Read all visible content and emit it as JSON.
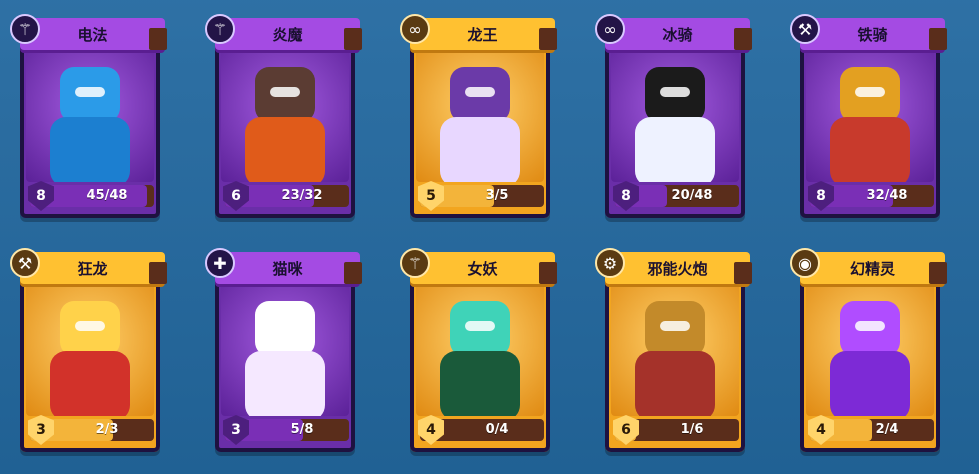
{
  "cards": [
    {
      "name": "电法",
      "level": "8",
      "progress": "45/48",
      "progress_value": 0.94,
      "theme": "purple",
      "role_icon": "staff-icon",
      "role_glyph": "⚚",
      "hero_colors": {
        "head": "#2b9be8",
        "body": "#1c7fd0"
      }
    },
    {
      "name": "炎魔",
      "level": "6",
      "progress": "23/32",
      "progress_value": 0.72,
      "theme": "purple",
      "role_icon": "staff-icon",
      "role_glyph": "⚚",
      "hero_colors": {
        "head": "#5b3c33",
        "body": "#e05b1a"
      }
    },
    {
      "name": "龙王",
      "level": "5",
      "progress": "3/5",
      "progress_value": 0.6,
      "theme": "gold",
      "role_icon": "ring-icon",
      "role_glyph": "∞",
      "hero_colors": {
        "head": "#6b3aa8",
        "body": "#e8d7ff"
      }
    },
    {
      "name": "冰骑",
      "level": "8",
      "progress": "20/48",
      "progress_value": 0.42,
      "theme": "purple",
      "role_icon": "ring-icon",
      "role_glyph": "∞",
      "hero_colors": {
        "head": "#1b1b1b",
        "body": "#eef2ff"
      }
    },
    {
      "name": "铁骑",
      "level": "8",
      "progress": "32/48",
      "progress_value": 0.67,
      "theme": "purple",
      "role_icon": "axe-icon",
      "role_glyph": "⚒",
      "hero_colors": {
        "head": "#e3a021",
        "body": "#c83a2c"
      }
    },
    {
      "name": "狂龙",
      "level": "3",
      "progress": "2/3",
      "progress_value": 0.67,
      "theme": "gold",
      "role_icon": "axe-icon",
      "role_glyph": "⚒",
      "hero_colors": {
        "head": "#ffd24a",
        "body": "#d2322a"
      }
    },
    {
      "name": "猫咪",
      "level": "3",
      "progress": "5/8",
      "progress_value": 0.63,
      "theme": "purple",
      "role_icon": "sparkle-icon",
      "role_glyph": "✚",
      "hero_colors": {
        "head": "#ffffff",
        "body": "#f5e8ff"
      }
    },
    {
      "name": "女妖",
      "level": "4",
      "progress": "0/4",
      "progress_value": 0.0,
      "theme": "gold",
      "role_icon": "staff-icon",
      "role_glyph": "⚚",
      "hero_colors": {
        "head": "#3fd3b8",
        "body": "#1a5a3a"
      }
    },
    {
      "name": "邪能火炮",
      "level": "6",
      "progress": "1/6",
      "progress_value": 0.17,
      "theme": "gold",
      "role_icon": "gear-icon",
      "role_glyph": "⚙",
      "hero_colors": {
        "head": "#c38a2a",
        "body": "#a5322a"
      }
    },
    {
      "name": "幻精灵",
      "level": "4",
      "progress": "2/4",
      "progress_value": 0.5,
      "theme": "gold",
      "role_icon": "pokeball-icon",
      "role_glyph": "◉",
      "hero_colors": {
        "head": "#b04dff",
        "body": "#7d2ad6"
      }
    }
  ]
}
